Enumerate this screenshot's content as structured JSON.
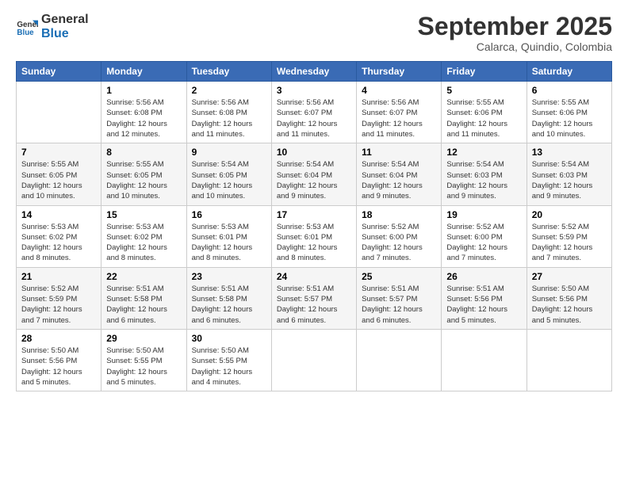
{
  "logo": {
    "line1": "General",
    "line2": "Blue"
  },
  "title": "September 2025",
  "subtitle": "Calarca, Quindio, Colombia",
  "headers": [
    "Sunday",
    "Monday",
    "Tuesday",
    "Wednesday",
    "Thursday",
    "Friday",
    "Saturday"
  ],
  "weeks": [
    [
      {
        "day": "",
        "info": ""
      },
      {
        "day": "1",
        "info": "Sunrise: 5:56 AM\nSunset: 6:08 PM\nDaylight: 12 hours\nand 12 minutes."
      },
      {
        "day": "2",
        "info": "Sunrise: 5:56 AM\nSunset: 6:08 PM\nDaylight: 12 hours\nand 11 minutes."
      },
      {
        "day": "3",
        "info": "Sunrise: 5:56 AM\nSunset: 6:07 PM\nDaylight: 12 hours\nand 11 minutes."
      },
      {
        "day": "4",
        "info": "Sunrise: 5:56 AM\nSunset: 6:07 PM\nDaylight: 12 hours\nand 11 minutes."
      },
      {
        "day": "5",
        "info": "Sunrise: 5:55 AM\nSunset: 6:06 PM\nDaylight: 12 hours\nand 11 minutes."
      },
      {
        "day": "6",
        "info": "Sunrise: 5:55 AM\nSunset: 6:06 PM\nDaylight: 12 hours\nand 10 minutes."
      }
    ],
    [
      {
        "day": "7",
        "info": "Sunrise: 5:55 AM\nSunset: 6:05 PM\nDaylight: 12 hours\nand 10 minutes."
      },
      {
        "day": "8",
        "info": "Sunrise: 5:55 AM\nSunset: 6:05 PM\nDaylight: 12 hours\nand 10 minutes."
      },
      {
        "day": "9",
        "info": "Sunrise: 5:54 AM\nSunset: 6:05 PM\nDaylight: 12 hours\nand 10 minutes."
      },
      {
        "day": "10",
        "info": "Sunrise: 5:54 AM\nSunset: 6:04 PM\nDaylight: 12 hours\nand 9 minutes."
      },
      {
        "day": "11",
        "info": "Sunrise: 5:54 AM\nSunset: 6:04 PM\nDaylight: 12 hours\nand 9 minutes."
      },
      {
        "day": "12",
        "info": "Sunrise: 5:54 AM\nSunset: 6:03 PM\nDaylight: 12 hours\nand 9 minutes."
      },
      {
        "day": "13",
        "info": "Sunrise: 5:54 AM\nSunset: 6:03 PM\nDaylight: 12 hours\nand 9 minutes."
      }
    ],
    [
      {
        "day": "14",
        "info": "Sunrise: 5:53 AM\nSunset: 6:02 PM\nDaylight: 12 hours\nand 8 minutes."
      },
      {
        "day": "15",
        "info": "Sunrise: 5:53 AM\nSunset: 6:02 PM\nDaylight: 12 hours\nand 8 minutes."
      },
      {
        "day": "16",
        "info": "Sunrise: 5:53 AM\nSunset: 6:01 PM\nDaylight: 12 hours\nand 8 minutes."
      },
      {
        "day": "17",
        "info": "Sunrise: 5:53 AM\nSunset: 6:01 PM\nDaylight: 12 hours\nand 8 minutes."
      },
      {
        "day": "18",
        "info": "Sunrise: 5:52 AM\nSunset: 6:00 PM\nDaylight: 12 hours\nand 7 minutes."
      },
      {
        "day": "19",
        "info": "Sunrise: 5:52 AM\nSunset: 6:00 PM\nDaylight: 12 hours\nand 7 minutes."
      },
      {
        "day": "20",
        "info": "Sunrise: 5:52 AM\nSunset: 5:59 PM\nDaylight: 12 hours\nand 7 minutes."
      }
    ],
    [
      {
        "day": "21",
        "info": "Sunrise: 5:52 AM\nSunset: 5:59 PM\nDaylight: 12 hours\nand 7 minutes."
      },
      {
        "day": "22",
        "info": "Sunrise: 5:51 AM\nSunset: 5:58 PM\nDaylight: 12 hours\nand 6 minutes."
      },
      {
        "day": "23",
        "info": "Sunrise: 5:51 AM\nSunset: 5:58 PM\nDaylight: 12 hours\nand 6 minutes."
      },
      {
        "day": "24",
        "info": "Sunrise: 5:51 AM\nSunset: 5:57 PM\nDaylight: 12 hours\nand 6 minutes."
      },
      {
        "day": "25",
        "info": "Sunrise: 5:51 AM\nSunset: 5:57 PM\nDaylight: 12 hours\nand 6 minutes."
      },
      {
        "day": "26",
        "info": "Sunrise: 5:51 AM\nSunset: 5:56 PM\nDaylight: 12 hours\nand 5 minutes."
      },
      {
        "day": "27",
        "info": "Sunrise: 5:50 AM\nSunset: 5:56 PM\nDaylight: 12 hours\nand 5 minutes."
      }
    ],
    [
      {
        "day": "28",
        "info": "Sunrise: 5:50 AM\nSunset: 5:56 PM\nDaylight: 12 hours\nand 5 minutes."
      },
      {
        "day": "29",
        "info": "Sunrise: 5:50 AM\nSunset: 5:55 PM\nDaylight: 12 hours\nand 5 minutes."
      },
      {
        "day": "30",
        "info": "Sunrise: 5:50 AM\nSunset: 5:55 PM\nDaylight: 12 hours\nand 4 minutes."
      },
      {
        "day": "",
        "info": ""
      },
      {
        "day": "",
        "info": ""
      },
      {
        "day": "",
        "info": ""
      },
      {
        "day": "",
        "info": ""
      }
    ]
  ]
}
